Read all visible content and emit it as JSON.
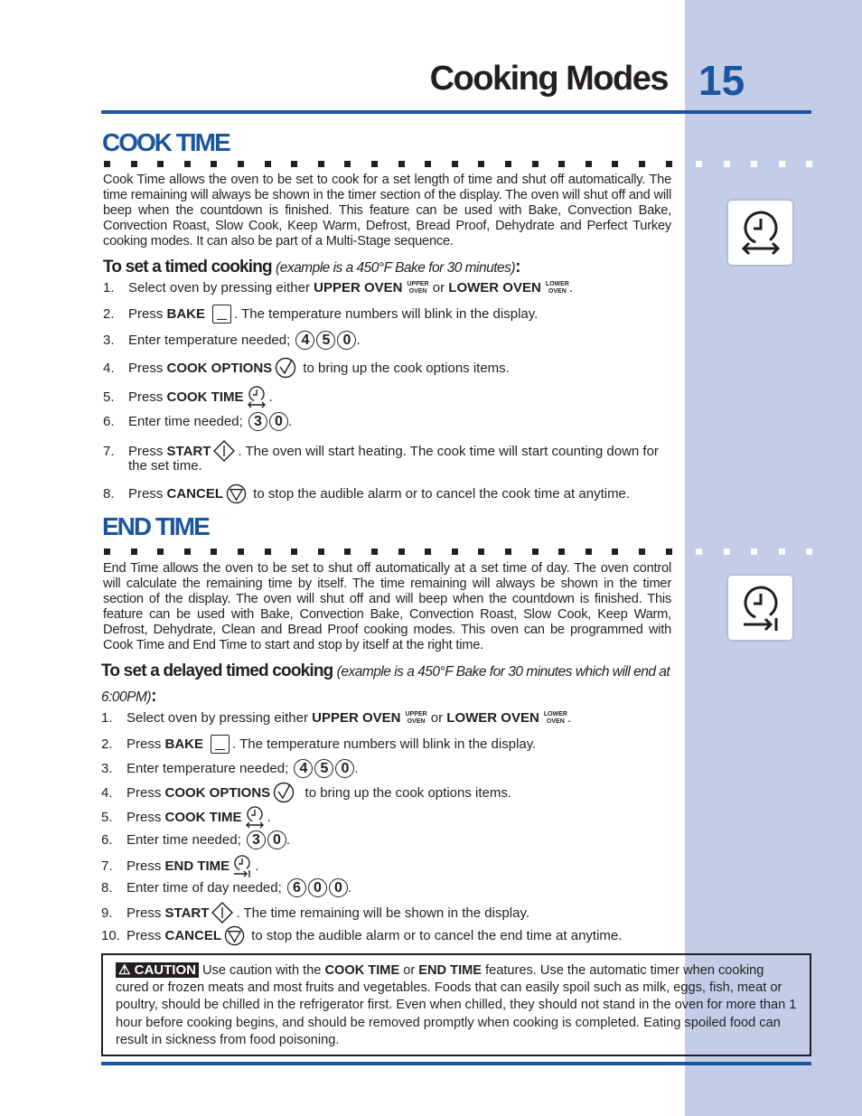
{
  "header": {
    "title": "Cooking Modes",
    "page_number": "15"
  },
  "colors": {
    "accent": "#1a56a0",
    "sidebar": "#c3cde8"
  },
  "cook_time": {
    "heading": "COOK TIME",
    "icon": "cook-time-clock-arrows-icon",
    "paragraph": "Cook Time allows the oven to be set to cook for a set length of time and shut off automatically. The time remaining will always be shown in the timer section of the display. The oven will shut off and will beep when the countdown is finished. This feature can be used with Bake, Convection Bake, Convection Roast, Slow Cook, Keep Warm, Defrost, Bread Proof, Dehydrate and Perfect Turkey cooking modes. It can also be part of a Multi-Stage sequence.",
    "subheading": "To set a timed cooking",
    "example": "(example is a 450°F Bake for 30 minutes)",
    "colon": ":",
    "steps": [
      [
        {
          "t": "Select oven by pressing either "
        },
        {
          "b": "UPPER OVEN"
        },
        {
          "ov": [
            "UPPER",
            "OVEN"
          ]
        },
        {
          "t": " or "
        },
        {
          "b": "LOWER OVEN"
        },
        {
          "ov": [
            "LOWER",
            "OVEN"
          ]
        },
        {
          "t": "."
        }
      ],
      [
        {
          "t": "Press "
        },
        {
          "b": "BAKE"
        },
        {
          "icon": "bake"
        },
        {
          "t": ". The temperature numbers will blink in the display."
        }
      ],
      [
        {
          "t": "Enter temperature needed; "
        },
        {
          "keys": [
            "4",
            "5",
            "0"
          ]
        },
        {
          "t": "."
        }
      ],
      [
        {
          "t": "Press "
        },
        {
          "b": "COOK OPTIONS"
        },
        {
          "icon": "options"
        },
        {
          "t": " to bring up the cook options items."
        }
      ],
      [
        {
          "t": "Press "
        },
        {
          "b": "COOK TIME"
        },
        {
          "icon": "cooktime"
        },
        {
          "t": "."
        }
      ],
      [
        {
          "t": "Enter time needed; "
        },
        {
          "keys": [
            "3",
            "0"
          ]
        },
        {
          "t": "."
        }
      ],
      [
        {
          "t": "Press "
        },
        {
          "b": "START"
        },
        {
          "icon": "start"
        },
        {
          "t": ". The oven will start heating. The cook time will start counting down for"
        }
      ],
      [
        {
          "t": "the set time."
        }
      ],
      [
        {
          "t": "Press "
        },
        {
          "b": "CANCEL"
        },
        {
          "icon": "cancel"
        },
        {
          "t": " to stop the audible alarm or to cancel the cook time at anytime."
        }
      ]
    ],
    "numbers": [
      "1.",
      "2.",
      "3.",
      "4.",
      "5.",
      "6.",
      "7.",
      "",
      "8."
    ]
  },
  "end_time": {
    "heading": "END TIME",
    "icon": "end-time-clock-arrow-icon",
    "paragraph": "End Time allows the oven to be set to shut off automatically at a set time of day. The oven control will calculate the remaining time by itself. The time remaining will always be shown in the timer section of the display. The oven will shut off and will beep when the countdown is finished. This feature can be used with Bake, Convection Bake, Convection Roast, Slow Cook, Keep Warm, Defrost, Dehydrate, Clean  and Bread Proof cooking modes. This oven can be programmed with Cook Time and End Time to start and stop by itself at the right time.",
    "subheading": "To set a delayed timed cooking",
    "example": "(example is a 450°F Bake for 30 minutes which will end at 6:00PM)",
    "colon": ":",
    "steps": [
      [
        {
          "t": "Select oven by pressing either "
        },
        {
          "b": "UPPER OVEN"
        },
        {
          "ov": [
            "UPPER",
            "OVEN"
          ]
        },
        {
          "t": " or "
        },
        {
          "b": "LOWER OVEN"
        },
        {
          "ov": [
            "LOWER",
            "OVEN"
          ]
        },
        {
          "t": "."
        }
      ],
      [
        {
          "t": "Press "
        },
        {
          "b": "BAKE"
        },
        {
          "icon": "bake"
        },
        {
          "t": ". The temperature numbers will blink in the display."
        }
      ],
      [
        {
          "t": "Enter temperature needed; "
        },
        {
          "keys": [
            "4",
            "5",
            "0"
          ]
        },
        {
          "t": "."
        }
      ],
      [
        {
          "t": "Press "
        },
        {
          "b": "COOK OPTIONS"
        },
        {
          "icon": "options"
        },
        {
          "t": "  to bring up the cook options items."
        }
      ],
      [
        {
          "t": "Press "
        },
        {
          "b": "COOK TIME"
        },
        {
          "icon": "cooktime"
        },
        {
          "t": "."
        }
      ],
      [
        {
          "t": "Enter time needed; "
        },
        {
          "keys": [
            "3",
            "0"
          ]
        },
        {
          "t": "."
        }
      ],
      [
        {
          "t": "Press "
        },
        {
          "b": "END TIME"
        },
        {
          "icon": "endtime"
        },
        {
          "t": "."
        }
      ],
      [
        {
          "t": "Enter time of day needed; "
        },
        {
          "keys": [
            "6",
            "0",
            "0"
          ]
        },
        {
          "t": "."
        }
      ],
      [
        {
          "t": "Press "
        },
        {
          "b": "START"
        },
        {
          "icon": "start"
        },
        {
          "t": ". The time remaining will be shown in the display."
        }
      ],
      [
        {
          "t": "Press "
        },
        {
          "b": "CANCEL"
        },
        {
          "icon": "cancel"
        },
        {
          "t": " to stop the audible alarm or to cancel the end time at anytime."
        }
      ]
    ],
    "numbers": [
      "1.",
      "2.",
      "3.",
      "4.",
      "5.",
      "6.",
      "7.",
      "8.",
      "9.",
      "10."
    ]
  },
  "caution": {
    "label": "CAUTION",
    "icon": "warning-triangle-icon",
    "segments": [
      {
        "t": " Use caution with the "
      },
      {
        "b": "COOK TIME"
      },
      {
        "t": " or "
      },
      {
        "b": "END TIME"
      },
      {
        "t": " features. Use the automatic timer when cooking cured or frozen meats and most fruits and vegetables. Foods that can easily spoil such as milk, eggs, fish, meat or poultry, should be chilled in the refrigerator first. Even when chilled, they should not stand in the oven for more than 1 hour before cooking begins, and should be removed promptly when cooking is completed. Eating spoiled food can result in sickness from food poisoning."
      }
    ]
  }
}
